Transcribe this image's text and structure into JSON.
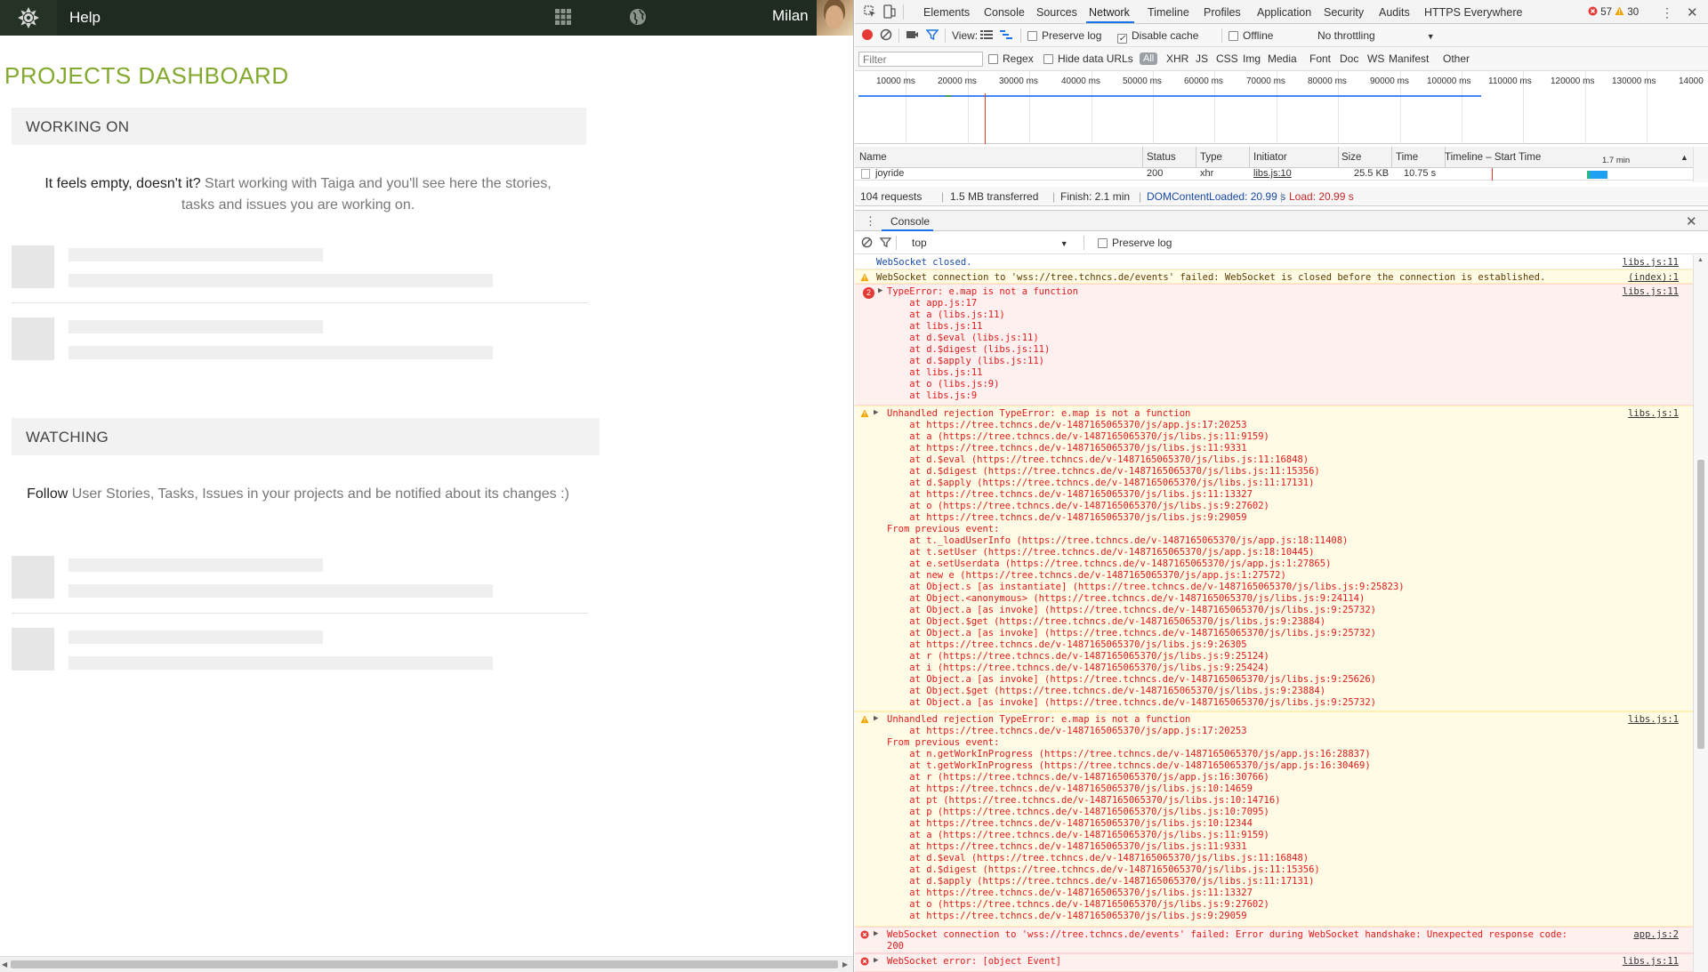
{
  "app": {
    "nav": {
      "help_label": "Help",
      "user_name": "Milan"
    },
    "page_title": "PROJECTS DASHBOARD",
    "working_on": {
      "heading": "WORKING ON",
      "msg_strong": "It feels empty, doesn't it?",
      "msg_rest": " Start working with Taiga and you'll see here the stories, tasks and issues you are working on."
    },
    "watching": {
      "heading": "WATCHING",
      "msg_strong": "Follow",
      "msg_rest": " User Stories, Tasks, Issues in your projects and be notified about its changes :)"
    }
  },
  "devtools": {
    "tabs": [
      "Elements",
      "Console",
      "Sources",
      "Network",
      "Timeline",
      "Profiles",
      "Application",
      "Security",
      "Audits",
      "HTTPS Everywhere"
    ],
    "active_tab": "Network",
    "error_count": "57",
    "warning_count": "30",
    "toolbar": {
      "view_label": "View:",
      "preserve_log": "Preserve log",
      "disable_cache": "Disable cache",
      "offline": "Offline",
      "throttling": "No throttling"
    },
    "filter_bar": {
      "filter_placeholder": "Filter",
      "regex": "Regex",
      "hide_data_urls": "Hide data URLs",
      "all": "All",
      "types": [
        "XHR",
        "JS",
        "CSS",
        "Img",
        "Media",
        "Font",
        "Doc",
        "WS",
        "Manifest",
        "Other"
      ]
    },
    "timeline_ticks": [
      "10000 ms",
      "20000 ms",
      "30000 ms",
      "40000 ms",
      "50000 ms",
      "60000 ms",
      "70000 ms",
      "80000 ms",
      "90000 ms",
      "100000 ms",
      "110000 ms",
      "120000 ms",
      "130000 ms",
      "14000"
    ],
    "network_table": {
      "headers": {
        "name": "Name",
        "status": "Status",
        "type": "Type",
        "initiator": "Initiator",
        "size": "Size",
        "time": "Time",
        "timeline": "Timeline – Start Time",
        "timeline_scale": "1.7 min"
      },
      "row": {
        "name": "joyride",
        "status": "200",
        "type": "xhr",
        "initiator": "libs.js:10",
        "size": "25.5 KB",
        "time": "10.75 s"
      }
    },
    "summary": {
      "requests": "104 requests",
      "transferred": "1.5 MB transferred",
      "finish": "Finish: 2.1 min",
      "dcl": "DOMContentLoaded: 20.99 s",
      "load": "Load: 20.99 s"
    },
    "console": {
      "tab_label": "Console",
      "context": "top",
      "preserve_log": "Preserve log",
      "messages": {
        "m1": {
          "text": "WebSocket closed.",
          "src": "libs.js:11"
        },
        "m2": {
          "text": "WebSocket connection to 'wss://tree.tchncs.de/events' failed: WebSocket is closed before the connection is established.",
          "src": "(index):1"
        },
        "m3": {
          "count": "2",
          "text": "TypeError: e.map is not a function",
          "src": "libs.js:11",
          "stack": "    at app.js:17\n    at a (libs.js:11)\n    at libs.js:11\n    at d.$eval (libs.js:11)\n    at d.$digest (libs.js:11)\n    at d.$apply (libs.js:11)\n    at libs.js:11\n    at o (libs.js:9)\n    at libs.js:9"
        },
        "m4": {
          "text": "Unhandled rejection TypeError: e.map is not a function",
          "src": "libs.js:1",
          "stack": "    at https://tree.tchncs.de/v-1487165065370/js/app.js:17:20253\n    at a (https://tree.tchncs.de/v-1487165065370/js/libs.js:11:9159)\n    at https://tree.tchncs.de/v-1487165065370/js/libs.js:11:9331\n    at d.$eval (https://tree.tchncs.de/v-1487165065370/js/libs.js:11:16848)\n    at d.$digest (https://tree.tchncs.de/v-1487165065370/js/libs.js:11:15356)\n    at d.$apply (https://tree.tchncs.de/v-1487165065370/js/libs.js:11:17131)\n    at https://tree.tchncs.de/v-1487165065370/js/libs.js:11:13327\n    at o (https://tree.tchncs.de/v-1487165065370/js/libs.js:9:27602)\n    at https://tree.tchncs.de/v-1487165065370/js/libs.js:9:29059\nFrom previous event:\n    at t._loadUserInfo (https://tree.tchncs.de/v-1487165065370/js/app.js:18:11408)\n    at t.setUser (https://tree.tchncs.de/v-1487165065370/js/app.js:18:10445)\n    at e.setUserdata (https://tree.tchncs.de/v-1487165065370/js/app.js:1:27865)\n    at new e (https://tree.tchncs.de/v-1487165065370/js/app.js:1:27572)\n    at Object.s [as instantiate] (https://tree.tchncs.de/v-1487165065370/js/libs.js:9:25823)\n    at Object.<anonymous> (https://tree.tchncs.de/v-1487165065370/js/libs.js:9:24114)\n    at Object.a [as invoke] (https://tree.tchncs.de/v-1487165065370/js/libs.js:9:25732)\n    at Object.$get (https://tree.tchncs.de/v-1487165065370/js/libs.js:9:23884)\n    at Object.a [as invoke] (https://tree.tchncs.de/v-1487165065370/js/libs.js:9:25732)\n    at https://tree.tchncs.de/v-1487165065370/js/libs.js:9:26305\n    at r (https://tree.tchncs.de/v-1487165065370/js/libs.js:9:25124)\n    at i (https://tree.tchncs.de/v-1487165065370/js/libs.js:9:25424)\n    at Object.a [as invoke] (https://tree.tchncs.de/v-1487165065370/js/libs.js:9:25626)\n    at Object.$get (https://tree.tchncs.de/v-1487165065370/js/libs.js:9:23884)\n    at Object.a [as invoke] (https://tree.tchncs.de/v-1487165065370/js/libs.js:9:25732)"
        },
        "m5": {
          "text": "Unhandled rejection TypeError: e.map is not a function",
          "src": "libs.js:1",
          "stack": "    at https://tree.tchncs.de/v-1487165065370/js/app.js:17:20253\nFrom previous event:\n    at n.getWorkInProgress (https://tree.tchncs.de/v-1487165065370/js/app.js:16:28837)\n    at t.getWorkInProgress (https://tree.tchncs.de/v-1487165065370/js/app.js:16:30469)\n    at r (https://tree.tchncs.de/v-1487165065370/js/app.js:16:30766)\n    at https://tree.tchncs.de/v-1487165065370/js/libs.js:10:14659\n    at pt (https://tree.tchncs.de/v-1487165065370/js/libs.js:10:14716)\n    at p (https://tree.tchncs.de/v-1487165065370/js/libs.js:10:7095)\n    at https://tree.tchncs.de/v-1487165065370/js/libs.js:10:12344\n    at a (https://tree.tchncs.de/v-1487165065370/js/libs.js:11:9159)\n    at https://tree.tchncs.de/v-1487165065370/js/libs.js:11:9331\n    at d.$eval (https://tree.tchncs.de/v-1487165065370/js/libs.js:11:16848)\n    at d.$digest (https://tree.tchncs.de/v-1487165065370/js/libs.js:11:15356)\n    at d.$apply (https://tree.tchncs.de/v-1487165065370/js/libs.js:11:17131)\n    at https://tree.tchncs.de/v-1487165065370/js/libs.js:11:13327\n    at o (https://tree.tchncs.de/v-1487165065370/js/libs.js:9:27602)\n    at https://tree.tchncs.de/v-1487165065370/js/libs.js:9:29059"
        },
        "m6": {
          "text": "WebSocket connection to 'wss://tree.tchncs.de/events' failed: Error during WebSocket handshake: Unexpected response code:\n200",
          "src": "app.js:2"
        },
        "m7": {
          "text": "WebSocket error: [object Event]",
          "src": "libs.js:11"
        }
      }
    }
  },
  "colors": {
    "taiga_green": "#83a92f",
    "nav_bg": "#1f2b20",
    "error_red": "#e01a1a",
    "warning_bg": "#fffbe5",
    "devtools_accent": "#1a73e8"
  },
  "icons": [
    "taiga-logo-icon",
    "grid-icon",
    "globe-icon",
    "inspect-icon",
    "device-icon",
    "record-icon",
    "clear-icon",
    "camera-icon",
    "filter-icon",
    "list-view-icon",
    "waterfall-icon",
    "error-icon",
    "warning-icon",
    "kebab-menu-icon",
    "close-icon"
  ]
}
